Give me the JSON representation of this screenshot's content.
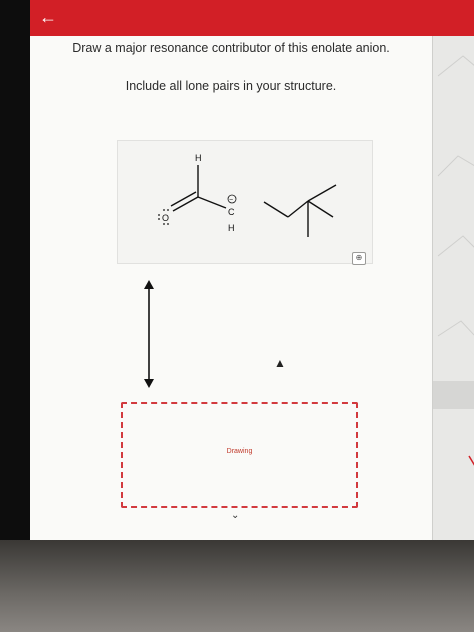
{
  "header": {
    "back_icon": "arrow-left-icon",
    "color": "#d21f26"
  },
  "question": {
    "prompt": "Draw a major resonance contributor of this enolate anion.",
    "instruction": "Include all lone pairs in your structure."
  },
  "molecule": {
    "atoms": {
      "oxygen": "O",
      "hydrogen_top": "H",
      "carbon": "C",
      "hydrogen_bottom": "H",
      "charge": "−"
    }
  },
  "zoom": {
    "icon": "zoom-icon",
    "glyph": "⊕"
  },
  "drawing": {
    "label": "Drawing",
    "border_color": "#d2393e"
  },
  "footer": {
    "chevron": "⌄"
  }
}
